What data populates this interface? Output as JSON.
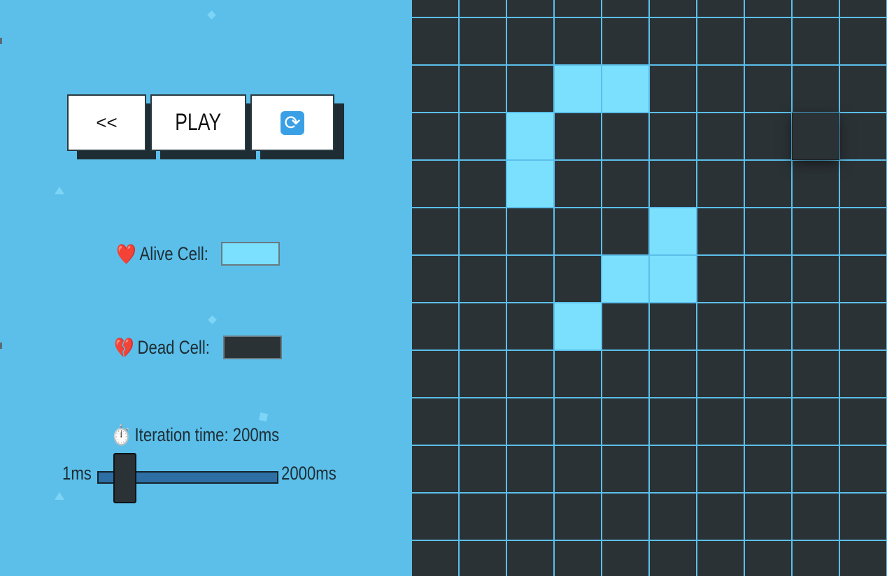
{
  "controls": {
    "back_label": "<<",
    "play_label": "PLAY",
    "reset_icon": "refresh-icon"
  },
  "legend": {
    "alive_icon": "heart",
    "alive_label": "Alive Cell:",
    "alive_color": "#7ae0fe",
    "dead_icon": "broken-heart",
    "dead_label": "Dead Cell:",
    "dead_color": "#2b3236"
  },
  "timer": {
    "icon": "stopwatch",
    "label": "Iteration time: 200ms",
    "min_label": "1ms",
    "max_label": "2000ms",
    "value_fraction": 0.05
  },
  "board": {
    "grid_line_color": "#5bbfea",
    "rows": 13,
    "cols": 10,
    "alive_cells": [
      [
        2,
        3
      ],
      [
        2,
        4
      ],
      [
        3,
        2
      ],
      [
        4,
        2
      ],
      [
        5,
        5
      ],
      [
        6,
        4
      ],
      [
        6,
        5
      ],
      [
        7,
        3
      ]
    ],
    "hovered_cell": [
      3,
      8
    ]
  }
}
